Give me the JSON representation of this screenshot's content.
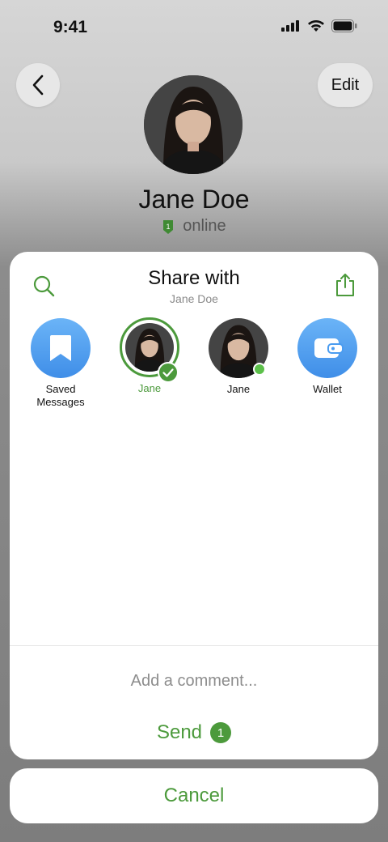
{
  "status_bar": {
    "time": "9:41"
  },
  "header": {
    "edit_label": "Edit"
  },
  "profile": {
    "name": "Jane Doe",
    "status": "online"
  },
  "sheet": {
    "title": "Share with",
    "subtitle": "Jane Doe",
    "targets": [
      {
        "label": "Saved Messages",
        "icon": "bookmark-icon",
        "selected": false
      },
      {
        "label": "Jane",
        "icon": "avatar",
        "selected": true
      },
      {
        "label": "Jane",
        "icon": "avatar",
        "selected": false,
        "online": true
      },
      {
        "label": "Wallet",
        "icon": "wallet-icon",
        "selected": false
      }
    ],
    "comment_placeholder": "Add a comment...",
    "send_label": "Send",
    "send_count": "1"
  },
  "cancel_label": "Cancel",
  "colors": {
    "accent": "#4c9a3c",
    "blue": "#4a9cf0"
  }
}
